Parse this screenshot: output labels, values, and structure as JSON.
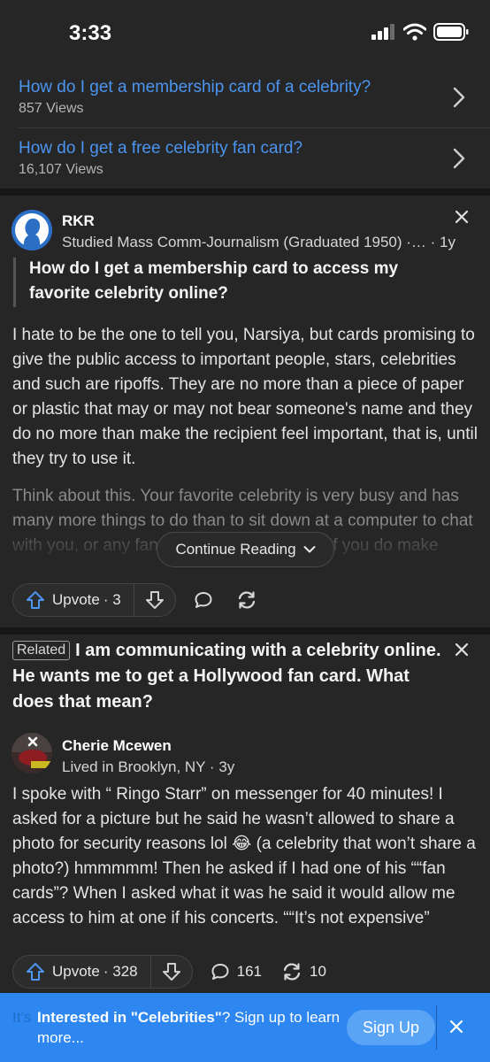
{
  "status": {
    "time": "3:33"
  },
  "related_questions": [
    {
      "title": "How do I get a membership card of a celebrity?",
      "views": "857 Views"
    },
    {
      "title": "How do I get a free celebrity fan card?",
      "views": "16,107 Views"
    }
  ],
  "answer1": {
    "author": "RKR",
    "credential": "Studied Mass Comm-Journalism (Graduated 1950) ·…",
    "age": "· 1y",
    "question_line1": "How do I get a membership card to access my",
    "question_line2": "favorite celebrity online?",
    "para1": "I hate to be the one to tell you, Narsiya, but cards promising to give the public access to important people, stars, celebrities and such are ripoffs. They are no more than a piece of paper or plastic that may or may not bear someone's name and they do no more than make the recipient feel important, that is, until they try to use it.",
    "para2": "Think about this. Your favorite celebrity is very busy and has many more things to do than to sit down at a computer to chat with you, or any fan for that matter, or not. If you do make contact, how do you know y",
    "continue_label": "Continue Reading",
    "upvote_label": "Upvote",
    "upvote_count": "· 3"
  },
  "answer2": {
    "related_tag": "Related",
    "question": "I am communicating with a celebrity online. He wants me to get a Hollywood fan card. What does that mean?",
    "author": "Cherie Mcewen",
    "credential": "Lived in Brooklyn, NY · 3y",
    "body": "I spoke with “ Ringo Starr” on messenger for 40 minutes! I asked for a picture but he said he wasn’t allowed to share a photo for security reasons lol 😂 (a celebrity that won’t share a photo?) hmmmmm! Then he asked if I had one of his ““fan cards”? When I asked what it was he said it would allow me access to him at one if his concerts. ““It’s not expensive”",
    "upvote_label": "Upvote",
    "upvote_count": "· 328",
    "comments": "161",
    "shares": "10"
  },
  "banner": {
    "underlay": "It’s",
    "prefix": "Interested in ",
    "topic": "\"Celebrities\"",
    "suffix": "? Sign up to learn more...",
    "signup_label": "Sign Up"
  },
  "colors": {
    "link": "#4b94f0",
    "banner": "#2e87f0",
    "background": "#262626"
  }
}
